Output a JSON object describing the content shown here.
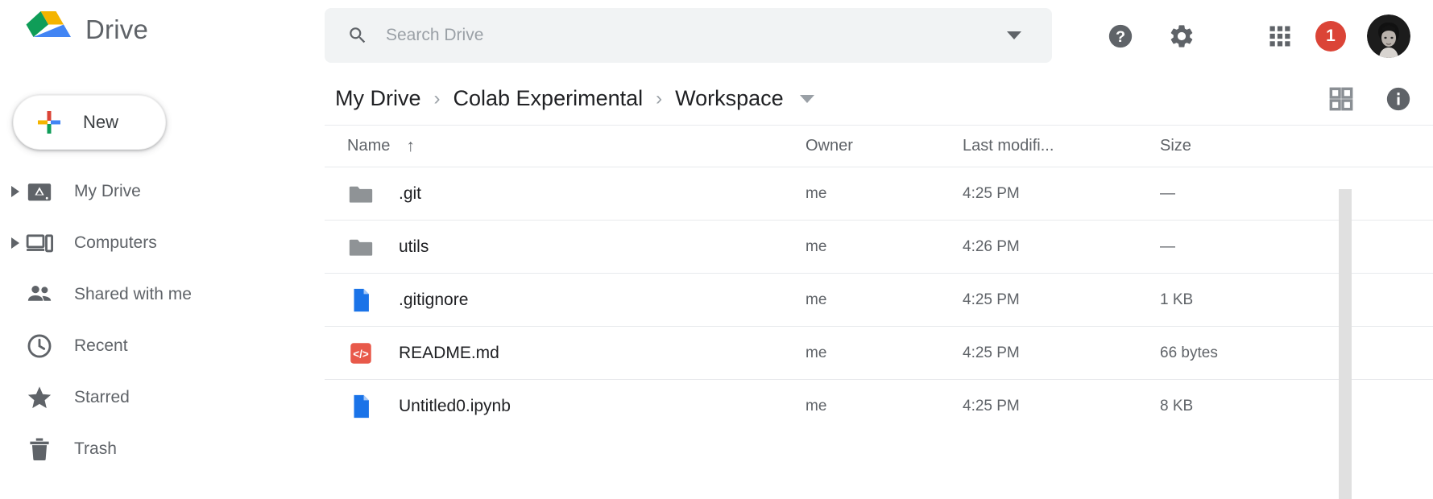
{
  "header": {
    "brand_title": "Drive",
    "logo_icon": "google-drive-logo",
    "search": {
      "icon": "search-icon",
      "placeholder": "Search Drive",
      "value": "",
      "caret_icon": "chevron-down-icon"
    },
    "actions": {
      "help_icon": "help-circle-icon",
      "settings_icon": "gear-icon",
      "apps_icon": "apps-grid-icon",
      "notification_count": "1",
      "avatar_icon": "user-avatar"
    }
  },
  "sidebar": {
    "new_button": {
      "label": "New",
      "icon": "plus-icon"
    },
    "items": [
      {
        "label": "My Drive",
        "icon": "drive-hdd-icon",
        "expandable": true
      },
      {
        "label": "Computers",
        "icon": "computers-icon",
        "expandable": true
      },
      {
        "label": "Shared with me",
        "icon": "people-icon",
        "expandable": false
      },
      {
        "label": "Recent",
        "icon": "clock-icon",
        "expandable": false
      },
      {
        "label": "Starred",
        "icon": "star-icon",
        "expandable": false
      },
      {
        "label": "Trash",
        "icon": "trash-icon",
        "expandable": false
      }
    ]
  },
  "main": {
    "breadcrumb": {
      "items": [
        "My Drive",
        "Colab Experimental",
        "Workspace"
      ],
      "separator": "›",
      "caret_icon": "chevron-down-icon"
    },
    "view_actions": {
      "grid_view_icon": "grid-view-icon",
      "info_icon": "info-circle-icon"
    },
    "table": {
      "headers": {
        "name": "Name",
        "sort_arrow": "↑",
        "owner": "Owner",
        "modified": "Last modifi...",
        "size": "Size"
      },
      "rows": [
        {
          "name": ".git",
          "icon": "folder-icon",
          "owner": "me",
          "modified": "4:25 PM",
          "size": "—"
        },
        {
          "name": "utils",
          "icon": "folder-icon",
          "owner": "me",
          "modified": "4:26 PM",
          "size": "—"
        },
        {
          "name": ".gitignore",
          "icon": "file-blue-icon",
          "owner": "me",
          "modified": "4:25 PM",
          "size": "1 KB"
        },
        {
          "name": "README.md",
          "icon": "code-file-icon",
          "owner": "me",
          "modified": "4:25 PM",
          "size": "66 bytes"
        },
        {
          "name": "Untitled0.ipynb",
          "icon": "file-blue-icon",
          "owner": "me",
          "modified": "4:25 PM",
          "size": "8 KB"
        }
      ]
    }
  },
  "colors": {
    "drive_blue": "#4285f4",
    "drive_green": "#0f9d58",
    "drive_yellow": "#f4b400",
    "drive_red": "#db4437",
    "code_file_red": "#e8594a",
    "folder_gray": "#8f9396",
    "text_primary": "#202124",
    "text_secondary": "#5f6368",
    "search_bg": "#f1f3f4",
    "divider": "#e8eaed",
    "scrollbar": "#e0e0e0"
  }
}
